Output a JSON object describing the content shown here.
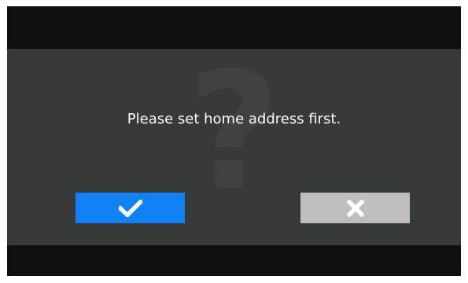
{
  "dialog": {
    "watermark_glyph": "?",
    "message": "Please set home address first.",
    "confirm_button": {
      "icon": "checkmark-icon",
      "color": "#1082f6"
    },
    "cancel_button": {
      "icon": "close-x-icon",
      "color": "#c0bdbd"
    }
  },
  "colors": {
    "screen_background": "#0e0f0f",
    "dialog_background": "#383a39",
    "text": "#ffffff"
  }
}
